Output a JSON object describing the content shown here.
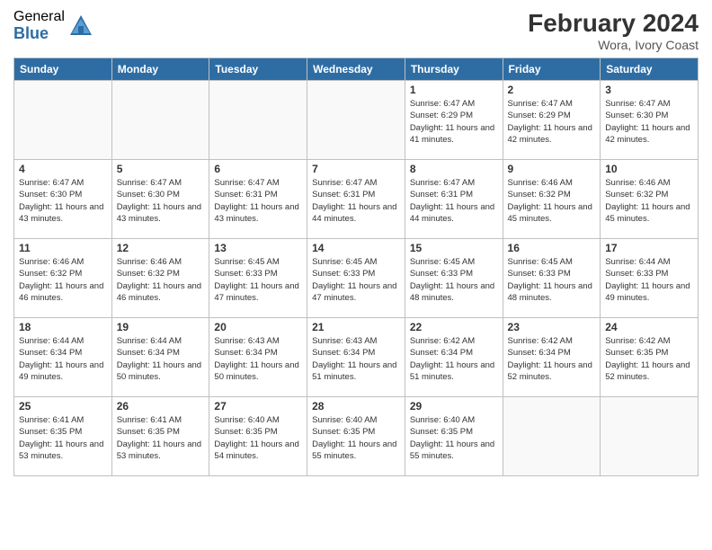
{
  "logo": {
    "general": "General",
    "blue": "Blue"
  },
  "header": {
    "month_year": "February 2024",
    "location": "Wora, Ivory Coast"
  },
  "weekdays": [
    "Sunday",
    "Monday",
    "Tuesday",
    "Wednesday",
    "Thursday",
    "Friday",
    "Saturday"
  ],
  "weeks": [
    [
      {
        "day": "",
        "info": ""
      },
      {
        "day": "",
        "info": ""
      },
      {
        "day": "",
        "info": ""
      },
      {
        "day": "",
        "info": ""
      },
      {
        "day": "1",
        "info": "Sunrise: 6:47 AM\nSunset: 6:29 PM\nDaylight: 11 hours and 41 minutes."
      },
      {
        "day": "2",
        "info": "Sunrise: 6:47 AM\nSunset: 6:29 PM\nDaylight: 11 hours and 42 minutes."
      },
      {
        "day": "3",
        "info": "Sunrise: 6:47 AM\nSunset: 6:30 PM\nDaylight: 11 hours and 42 minutes."
      }
    ],
    [
      {
        "day": "4",
        "info": "Sunrise: 6:47 AM\nSunset: 6:30 PM\nDaylight: 11 hours and 43 minutes."
      },
      {
        "day": "5",
        "info": "Sunrise: 6:47 AM\nSunset: 6:30 PM\nDaylight: 11 hours and 43 minutes."
      },
      {
        "day": "6",
        "info": "Sunrise: 6:47 AM\nSunset: 6:31 PM\nDaylight: 11 hours and 43 minutes."
      },
      {
        "day": "7",
        "info": "Sunrise: 6:47 AM\nSunset: 6:31 PM\nDaylight: 11 hours and 44 minutes."
      },
      {
        "day": "8",
        "info": "Sunrise: 6:47 AM\nSunset: 6:31 PM\nDaylight: 11 hours and 44 minutes."
      },
      {
        "day": "9",
        "info": "Sunrise: 6:46 AM\nSunset: 6:32 PM\nDaylight: 11 hours and 45 minutes."
      },
      {
        "day": "10",
        "info": "Sunrise: 6:46 AM\nSunset: 6:32 PM\nDaylight: 11 hours and 45 minutes."
      }
    ],
    [
      {
        "day": "11",
        "info": "Sunrise: 6:46 AM\nSunset: 6:32 PM\nDaylight: 11 hours and 46 minutes."
      },
      {
        "day": "12",
        "info": "Sunrise: 6:46 AM\nSunset: 6:32 PM\nDaylight: 11 hours and 46 minutes."
      },
      {
        "day": "13",
        "info": "Sunrise: 6:45 AM\nSunset: 6:33 PM\nDaylight: 11 hours and 47 minutes."
      },
      {
        "day": "14",
        "info": "Sunrise: 6:45 AM\nSunset: 6:33 PM\nDaylight: 11 hours and 47 minutes."
      },
      {
        "day": "15",
        "info": "Sunrise: 6:45 AM\nSunset: 6:33 PM\nDaylight: 11 hours and 48 minutes."
      },
      {
        "day": "16",
        "info": "Sunrise: 6:45 AM\nSunset: 6:33 PM\nDaylight: 11 hours and 48 minutes."
      },
      {
        "day": "17",
        "info": "Sunrise: 6:44 AM\nSunset: 6:33 PM\nDaylight: 11 hours and 49 minutes."
      }
    ],
    [
      {
        "day": "18",
        "info": "Sunrise: 6:44 AM\nSunset: 6:34 PM\nDaylight: 11 hours and 49 minutes."
      },
      {
        "day": "19",
        "info": "Sunrise: 6:44 AM\nSunset: 6:34 PM\nDaylight: 11 hours and 50 minutes."
      },
      {
        "day": "20",
        "info": "Sunrise: 6:43 AM\nSunset: 6:34 PM\nDaylight: 11 hours and 50 minutes."
      },
      {
        "day": "21",
        "info": "Sunrise: 6:43 AM\nSunset: 6:34 PM\nDaylight: 11 hours and 51 minutes."
      },
      {
        "day": "22",
        "info": "Sunrise: 6:42 AM\nSunset: 6:34 PM\nDaylight: 11 hours and 51 minutes."
      },
      {
        "day": "23",
        "info": "Sunrise: 6:42 AM\nSunset: 6:34 PM\nDaylight: 11 hours and 52 minutes."
      },
      {
        "day": "24",
        "info": "Sunrise: 6:42 AM\nSunset: 6:35 PM\nDaylight: 11 hours and 52 minutes."
      }
    ],
    [
      {
        "day": "25",
        "info": "Sunrise: 6:41 AM\nSunset: 6:35 PM\nDaylight: 11 hours and 53 minutes."
      },
      {
        "day": "26",
        "info": "Sunrise: 6:41 AM\nSunset: 6:35 PM\nDaylight: 11 hours and 53 minutes."
      },
      {
        "day": "27",
        "info": "Sunrise: 6:40 AM\nSunset: 6:35 PM\nDaylight: 11 hours and 54 minutes."
      },
      {
        "day": "28",
        "info": "Sunrise: 6:40 AM\nSunset: 6:35 PM\nDaylight: 11 hours and 55 minutes."
      },
      {
        "day": "29",
        "info": "Sunrise: 6:40 AM\nSunset: 6:35 PM\nDaylight: 11 hours and 55 minutes."
      },
      {
        "day": "",
        "info": ""
      },
      {
        "day": "",
        "info": ""
      }
    ]
  ]
}
